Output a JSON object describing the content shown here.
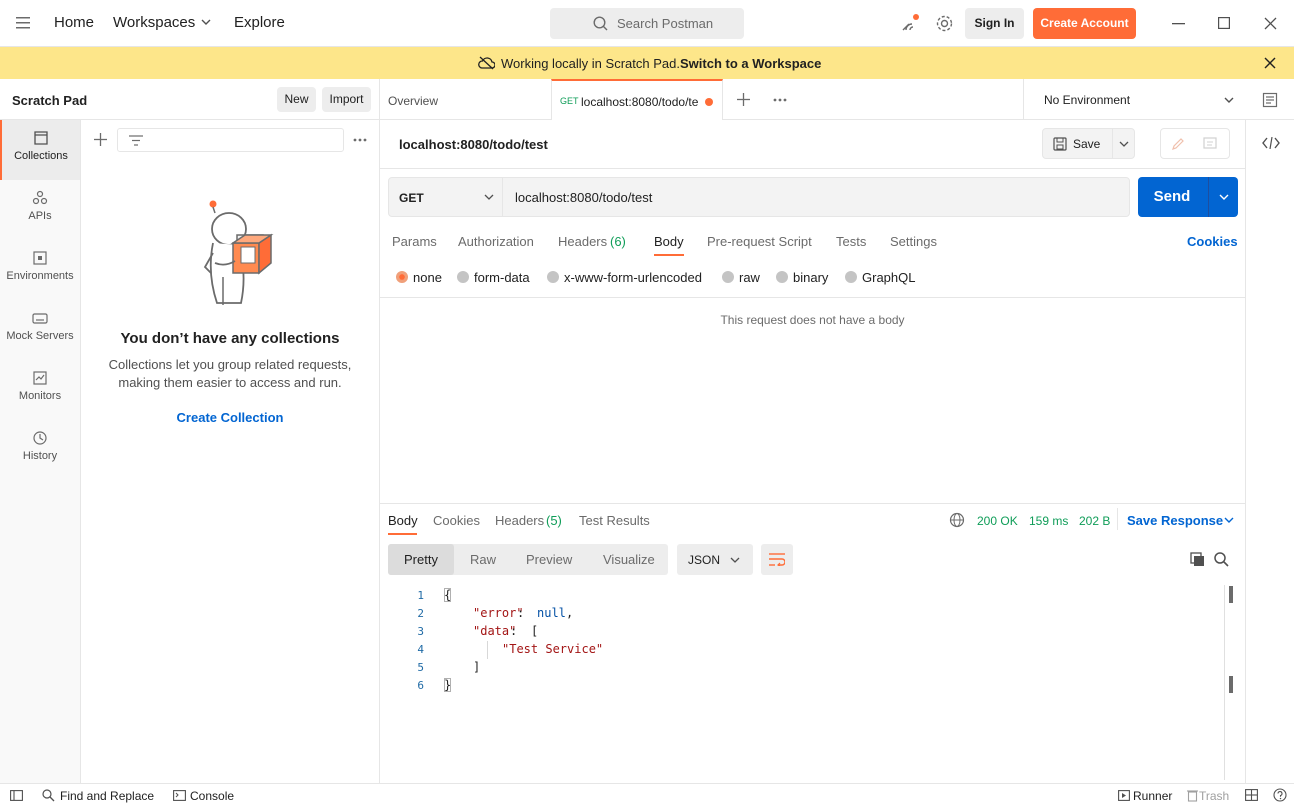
{
  "topbar": {
    "home": "Home",
    "workspaces": "Workspaces",
    "explore": "Explore",
    "search_placeholder": "Search Postman",
    "sign_in": "Sign In",
    "create_account": "Create Account"
  },
  "banner": {
    "text": "Working locally in Scratch Pad.",
    "link": "Switch to a Workspace"
  },
  "sidebar": {
    "title": "Scratch Pad",
    "new_button": "New",
    "import_button": "Import",
    "rail": [
      {
        "label": "Collections",
        "icon": "collections-icon"
      },
      {
        "label": "APIs",
        "icon": "apis-icon"
      },
      {
        "label": "Environments",
        "icon": "environments-icon"
      },
      {
        "label": "Mock Servers",
        "icon": "mock-servers-icon"
      },
      {
        "label": "Monitors",
        "icon": "monitors-icon"
      },
      {
        "label": "History",
        "icon": "history-icon"
      }
    ],
    "empty_title": "You don’t have any collections",
    "empty_desc_1": "Collections let you group related requests,",
    "empty_desc_2": "making them easier to access and run.",
    "create_collection": "Create Collection"
  },
  "tabs": {
    "overview": "Overview",
    "active_method": "GET",
    "active_label": "localhost:8080/todo/te",
    "environment": "No Environment"
  },
  "request": {
    "title": "localhost:8080/todo/test",
    "save": "Save",
    "method": "GET",
    "url": "localhost:8080/todo/test",
    "send": "Send",
    "subtabs": {
      "params": "Params",
      "authorization": "Authorization",
      "headers": "Headers",
      "headers_count": "(6)",
      "body": "Body",
      "prerequest": "Pre-request Script",
      "tests": "Tests",
      "settings": "Settings",
      "cookies": "Cookies"
    },
    "body_types": {
      "none": "none",
      "form_data": "form-data",
      "urlencoded": "x-www-form-urlencoded",
      "raw": "raw",
      "binary": "binary",
      "graphql": "GraphQL"
    },
    "no_body": "This request does not have a body"
  },
  "response": {
    "tabs": {
      "body": "Body",
      "cookies": "Cookies",
      "headers": "Headers",
      "headers_count": "(5)",
      "test_results": "Test Results"
    },
    "status": "200 OK",
    "time": "159 ms",
    "size": "202 B",
    "save_response": "Save Response",
    "views": {
      "pretty": "Pretty",
      "raw": "Raw",
      "preview": "Preview",
      "visualize": "Visualize"
    },
    "format": "JSON",
    "lines": [
      "1",
      "2",
      "3",
      "4",
      "5",
      "6"
    ],
    "code": {
      "l1": "{",
      "l2_key": "\"error\"",
      "l2_sep": ": ",
      "l2_val": "null",
      "l2_end": ",",
      "l3_key": "\"data\"",
      "l3_sep": ": ",
      "l3_open": "[",
      "l4": "\"Test Service\"",
      "l5": "]",
      "l6": "}"
    }
  },
  "statusbar": {
    "find_replace": "Find and Replace",
    "console": "Console",
    "runner": "Runner",
    "trash": "Trash"
  },
  "colors": {
    "accent": "#ff6c37",
    "send": "#0265d2",
    "link": "#0265d2",
    "banner": "#fde68a",
    "ok": "#0f9d58"
  }
}
